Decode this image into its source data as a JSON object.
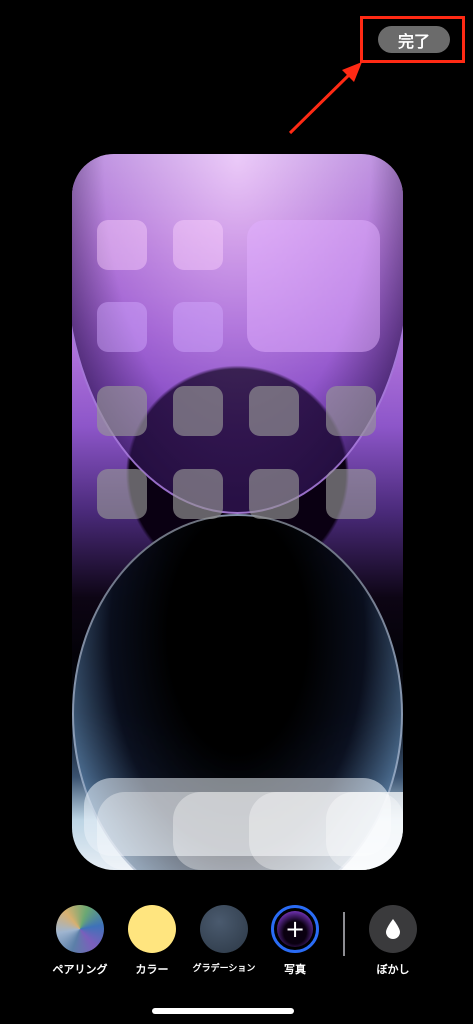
{
  "header": {
    "done_label": "完了"
  },
  "toolbar": {
    "items": [
      {
        "label": "ペアリング",
        "icon": "pairing-swatch-icon"
      },
      {
        "label": "カラー",
        "icon": "color-swatch-icon"
      },
      {
        "label": "グラデーション",
        "icon": "gradient-swatch-icon"
      },
      {
        "label": "写真",
        "icon": "photo-add-icon",
        "glyph": "+"
      },
      {
        "label": "ぼかし",
        "icon": "blur-drop-icon"
      }
    ]
  },
  "colors": {
    "annotation": "#ff2a14",
    "accent": "#2a6cf5",
    "color_swatch": "#ffe57f"
  }
}
